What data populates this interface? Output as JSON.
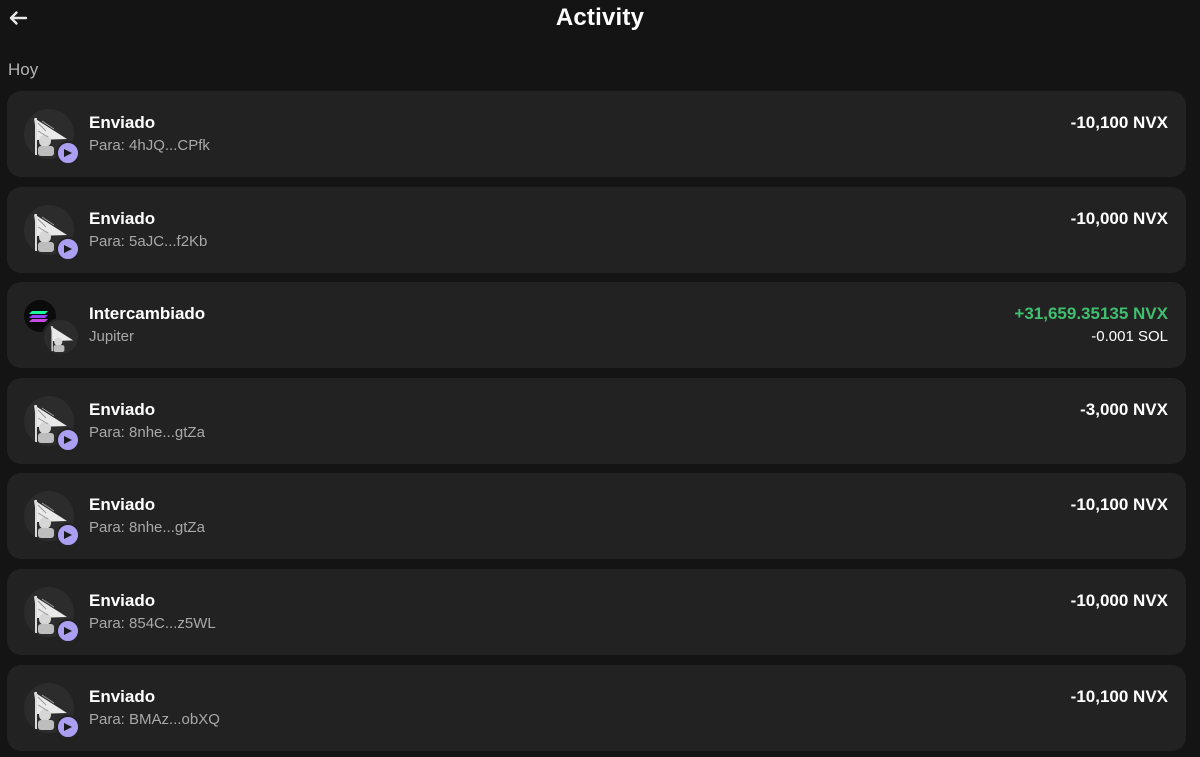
{
  "header": {
    "title": "Activity",
    "back_icon": "arrow-left-icon"
  },
  "section": {
    "label": "Hoy"
  },
  "colors": {
    "background": "#141414",
    "row_background": "#222222",
    "accent_badge": "#ab9ff2",
    "positive": "#3fbf6f",
    "secondary_text": "#a8a8a8"
  },
  "activities": [
    {
      "type": "sent",
      "title": "Enviado",
      "subtitle": "Para: 4hJQ...CPfk",
      "amount": "-10,100 NVX",
      "icon": "send-arrow-icon"
    },
    {
      "type": "sent",
      "title": "Enviado",
      "subtitle": "Para: 5aJC...f2Kb",
      "amount": "-10,000 NVX",
      "icon": "send-arrow-icon"
    },
    {
      "type": "swap",
      "title": "Intercambiado",
      "subtitle": "Jupiter",
      "amount": "+31,659.35135 NVX",
      "amount_secondary": "-0.001 SOL",
      "icon": "swap-tokens-icon"
    },
    {
      "type": "sent",
      "title": "Enviado",
      "subtitle": "Para: 8nhe...gtZa",
      "amount": "-3,000 NVX",
      "icon": "send-arrow-icon"
    },
    {
      "type": "sent",
      "title": "Enviado",
      "subtitle": "Para: 8nhe...gtZa",
      "amount": "-10,100 NVX",
      "icon": "send-arrow-icon"
    },
    {
      "type": "sent",
      "title": "Enviado",
      "subtitle": "Para: 854C...z5WL",
      "amount": "-10,000 NVX",
      "icon": "send-arrow-icon"
    },
    {
      "type": "sent",
      "title": "Enviado",
      "subtitle": "Para: BMAz...obXQ",
      "amount": "-10,100 NVX",
      "icon": "send-arrow-icon"
    }
  ]
}
